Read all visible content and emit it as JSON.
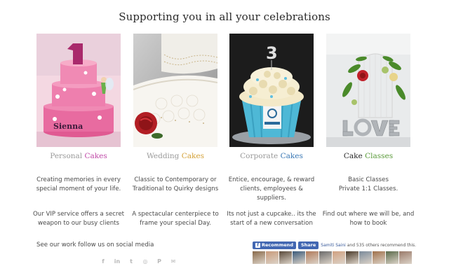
{
  "page_title": "Supporting you in all your celebrations",
  "cards": [
    {
      "title_parts": [
        {
          "text": "Personal  ",
          "color": "#9a9a9a"
        },
        {
          "text": "Cakes",
          "color": "#c04aa8"
        }
      ],
      "text1": "Creating memories in every special moment of your life.",
      "text2": "Our VIP service offers a secret weapon to our busy clients",
      "image": "pink-fairy-tiered-cake"
    },
    {
      "title_parts": [
        {
          "text": "Wedding ",
          "color": "#9a9a9a"
        },
        {
          "text": "Cakes",
          "color": "#d4a23a"
        }
      ],
      "text1": "Classic to Contemporary or Traditional to Quirky  designs",
      "text2": "A spectacular centerpiece to frame your special Day.",
      "image": "white-lace-wedding-cake-red-rose"
    },
    {
      "title_parts": [
        {
          "text": "Corporate ",
          "color": "#9a9a9a"
        },
        {
          "text": "Cakes",
          "color": "#3a78b5"
        }
      ],
      "text1": "Entice, encourage, & reward clients, employees & suppliers.",
      "text2": "Its not just a cupcake.. its the start of a new conversation",
      "image": "giant-cupcake-number-3"
    },
    {
      "title_parts": [
        {
          "text": "Cake ",
          "color": "#2a2a2a"
        },
        {
          "text": "Classes",
          "color": "#5a9a3a"
        }
      ],
      "text1": "Basic Classes\nPrivate 1:1 Classes.",
      "text2": "Find out where we will be, and how to book",
      "image": "love-letters-with-flowers"
    }
  ],
  "social": {
    "text": "See our work follow us on social media",
    "icons": [
      {
        "name": "facebook-icon",
        "glyph": "f"
      },
      {
        "name": "linkedin-icon",
        "glyph": "in"
      },
      {
        "name": "twitter-icon",
        "glyph": "t"
      },
      {
        "name": "instagram-icon",
        "glyph": "◎"
      },
      {
        "name": "pinterest-icon",
        "glyph": "P"
      },
      {
        "name": "email-icon",
        "glyph": "✉"
      }
    ]
  },
  "facebook": {
    "recommend_label": "Recommend",
    "share_label": "Share",
    "summary_name": "Samiti Saini",
    "summary_rest": " and 535 others recommend this.",
    "face_count": 12
  }
}
